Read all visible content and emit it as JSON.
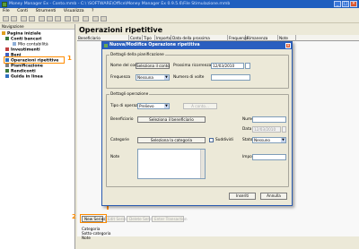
{
  "window": {
    "title": "Money Manager Ex - Conto.mmb - C:\\ \\SOFTWARE\\Office\\Money Manager Ex 0.9.5.6\\File Stimulazione.mmb"
  },
  "menubar": [
    "File",
    "Conti",
    "Strumenti",
    "Visualizza",
    "?"
  ],
  "nav": {
    "header": "Navigazione",
    "items": [
      {
        "label": "Pagina iniziale"
      },
      {
        "label": "Conti bancari"
      },
      {
        "label": "Mio contabilità"
      },
      {
        "label": "Investimenti"
      },
      {
        "label": "Beni"
      },
      {
        "label": "Operazioni ripetitive"
      },
      {
        "label": "Pianificazione"
      },
      {
        "label": "Rendiconti"
      },
      {
        "label": "Guida in linea"
      }
    ]
  },
  "main": {
    "title": "Operazioni ripetitive",
    "columns": [
      "Beneficiario",
      "Conto",
      "Tipo",
      "Importo",
      "Data della prossima scadenza",
      "Frequenza",
      "Rimanenza giorni",
      "Note"
    ],
    "buttons": [
      "New Series",
      "Edit Series",
      "Delete Series",
      "Enter Transaction"
    ],
    "detail": [
      "Categoria",
      "Sotto-categoria",
      "Note"
    ]
  },
  "dialog": {
    "title": "Nuova/Modifica Operazione ripetitiva",
    "close": "×",
    "plan": {
      "title": "Dettagli della pianificazione",
      "account_label": "Nome del conto",
      "account_button": "Seleziona il conto",
      "next_due_label": "Prossima ricorrenza",
      "next_due_value": "12/03/2010",
      "frequency_label": "Frequenza",
      "frequency_value": "Nessuna",
      "times_label": "Numero di volte",
      "times_value": ""
    },
    "op": {
      "title": "Dettagli operazione",
      "type_label": "Tipo di operazione",
      "type_value": "Prelievo",
      "account_button": "A conto...",
      "payee_label": "Beneficiario",
      "payee_button": "Seleziona il beneficiario",
      "number_label": "Numero",
      "number_value": "",
      "date_label": "Data",
      "date_value": "12/03/2010",
      "category_label": "Categorie",
      "category_button": "Seleziona la categoria",
      "split_label": "Suddividi",
      "status_label": "Stato",
      "status_value": "Nessuno",
      "notes_label": "Note",
      "amount_label": "Importo",
      "amount_value": ""
    },
    "ok": "Inseriti",
    "cancel": "Annulla"
  },
  "callouts": [
    "1",
    "2",
    "3"
  ],
  "colors": {
    "highlight": "#ff8c00",
    "titlebar": "#1f5fbf"
  }
}
